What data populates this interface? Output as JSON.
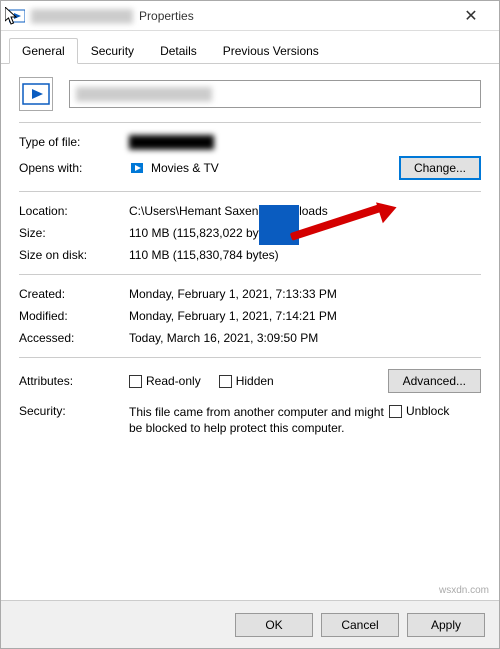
{
  "titlebar": {
    "filename_obscured": "████████████",
    "title_suffix": "Properties"
  },
  "tabs": {
    "general": "General",
    "security": "Security",
    "details": "Details",
    "previous": "Previous Versions"
  },
  "file": {
    "name_obscured": "████████████████"
  },
  "labels": {
    "type": "Type of file:",
    "opens": "Opens with:",
    "location": "Location:",
    "size": "Size:",
    "size_on_disk": "Size on disk:",
    "created": "Created:",
    "modified": "Modified:",
    "accessed": "Accessed:",
    "attributes": "Attributes:",
    "security": "Security:"
  },
  "values": {
    "type_obscured": "██████████",
    "opens": "Movies & TV",
    "location": "C:\\Users\\Hemant Saxena\\Downloads",
    "size": "110 MB (115,823,022 bytes)",
    "size_on_disk": "110 MB (115,830,784 bytes)",
    "created": "Monday, February 1, 2021, 7:13:33 PM",
    "modified": "Monday, February 1, 2021, 7:14:21 PM",
    "accessed": "Today, March 16, 2021, 3:09:50 PM",
    "security_text": "This file came from another computer and might be blocked to help protect this computer."
  },
  "buttons": {
    "change": "Change...",
    "advanced": "Advanced...",
    "ok": "OK",
    "cancel": "Cancel",
    "apply": "Apply"
  },
  "checkboxes": {
    "readonly": "Read-only",
    "hidden": "Hidden",
    "unblock": "Unblock"
  },
  "watermark": "wsxdn.com"
}
